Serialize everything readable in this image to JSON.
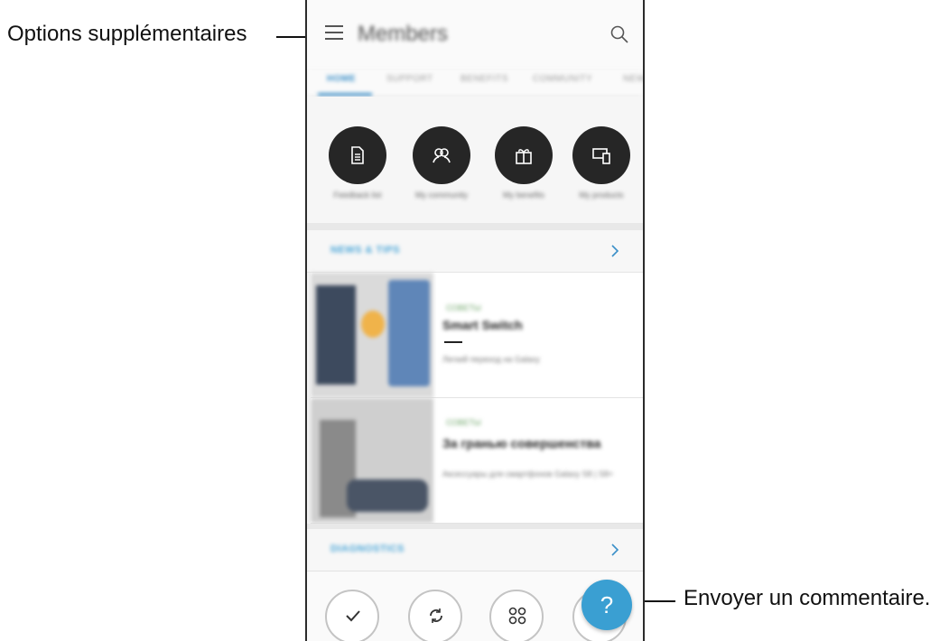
{
  "annotations": {
    "menu_label": "Options supplémentaires",
    "feedback_label": "Envoyer un commentaire."
  },
  "app": {
    "title": "Members",
    "tabs": [
      "HOME",
      "SUPPORT",
      "BENEFITS",
      "COMMUNITY",
      "NEW"
    ],
    "active_tab": "HOME"
  },
  "quick_actions": [
    {
      "label": "Feedback list",
      "icon": "document-icon"
    },
    {
      "label": "My community",
      "icon": "community-icon"
    },
    {
      "label": "My benefits",
      "icon": "gift-icon"
    },
    {
      "label": "My products",
      "icon": "devices-icon"
    }
  ],
  "news": {
    "title": "NEWS & TIPS",
    "cards": [
      {
        "tag": "СОВЕТЫ",
        "title": "Smart Switch",
        "desc": "Легкий переход на Galaxy"
      },
      {
        "tag": "СОВЕТЫ",
        "title": "За гранью совершенства",
        "desc": "Аксессуары для смартфонов Galaxy S8 | S8+"
      }
    ]
  },
  "diagnostics": {
    "title": "DIAGNOSTICS"
  },
  "bottom_nav": [
    {
      "icon": "check-icon"
    },
    {
      "icon": "refresh-icon"
    },
    {
      "icon": "apps-icon"
    }
  ],
  "fab": {
    "label": "?",
    "icon": "question-icon"
  },
  "colors": {
    "accent": "#3a9fd2",
    "dark_circle": "#262626",
    "tag_green": "#6fa66a"
  }
}
